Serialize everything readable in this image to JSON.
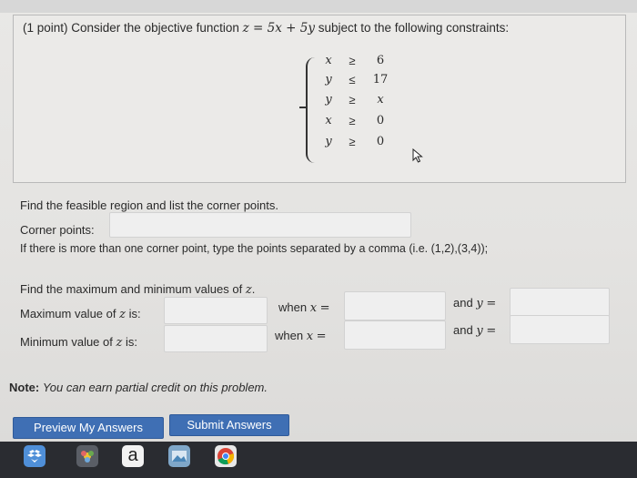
{
  "problem": {
    "intro_prefix": "(1 point) Consider the objective function",
    "objective": "z = 5x + 5y",
    "intro_suffix": "subject to the following constraints:",
    "constraints": [
      {
        "lhs": "x",
        "op": "≥",
        "rhs": "6"
      },
      {
        "lhs": "y",
        "op": "≤",
        "rhs": "17"
      },
      {
        "lhs": "y",
        "op": "≥",
        "rhs": "x"
      },
      {
        "lhs": "x",
        "op": "≥",
        "rhs": "0"
      },
      {
        "lhs": "y",
        "op": "≥",
        "rhs": "0"
      }
    ]
  },
  "feasible": {
    "instruction": "Find the feasible region and list the corner points.",
    "corner_label": "Corner points:",
    "corner_value": "",
    "hint": "If there is more than one corner point, type the points separated by a comma (i.e. (1,2),(3,4));"
  },
  "extrema": {
    "instruction_prefix": "Find the maximum and minimum values of",
    "instruction_var": "z",
    "instruction_suffix": ".",
    "max_label_prefix": "Maximum value of",
    "min_label_prefix": "Minimum value of",
    "label_var": "z",
    "label_suffix": "is:",
    "when_x": "when",
    "x_var": "x",
    "eq": "=",
    "and_y": "and",
    "y_var": "y",
    "max_value": "",
    "max_x": "",
    "max_y": "",
    "min_value": "",
    "min_x": "",
    "min_y": ""
  },
  "note": {
    "label": "Note:",
    "text": "You can earn partial credit on this problem."
  },
  "buttons": {
    "preview": "Preview My Answers",
    "submit": "Submit Answers"
  },
  "dock": {
    "icons": [
      "dropbox-icon",
      "photos-icon",
      "amazon-icon",
      "preview-icon",
      "chrome-icon"
    ],
    "amazon_glyph": "a"
  }
}
